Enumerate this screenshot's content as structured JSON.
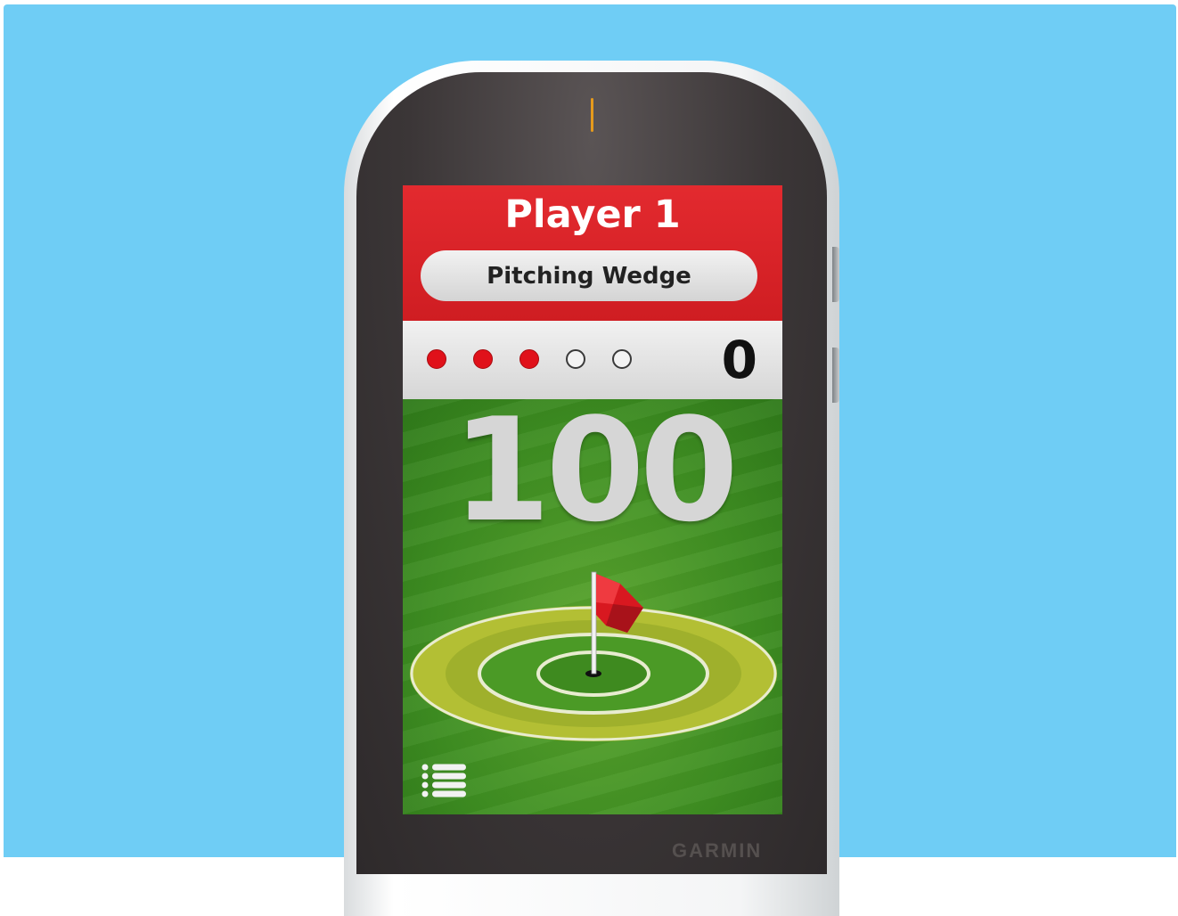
{
  "device": {
    "brand": "GARMIN"
  },
  "header": {
    "player_name": "Player 1",
    "club": "Pitching Wedge"
  },
  "shots": {
    "total": 5,
    "taken": 3,
    "score": "0"
  },
  "distance": {
    "value": "100"
  },
  "icons": {
    "flag": "flag-icon",
    "menu": "menu-list-icon"
  },
  "colors": {
    "header_red": "#e32a2f",
    "shot_red": "#e0111a",
    "green": "#3f8f22",
    "ring_yellow": "#b9c63a",
    "background": "#6fcdf5"
  }
}
